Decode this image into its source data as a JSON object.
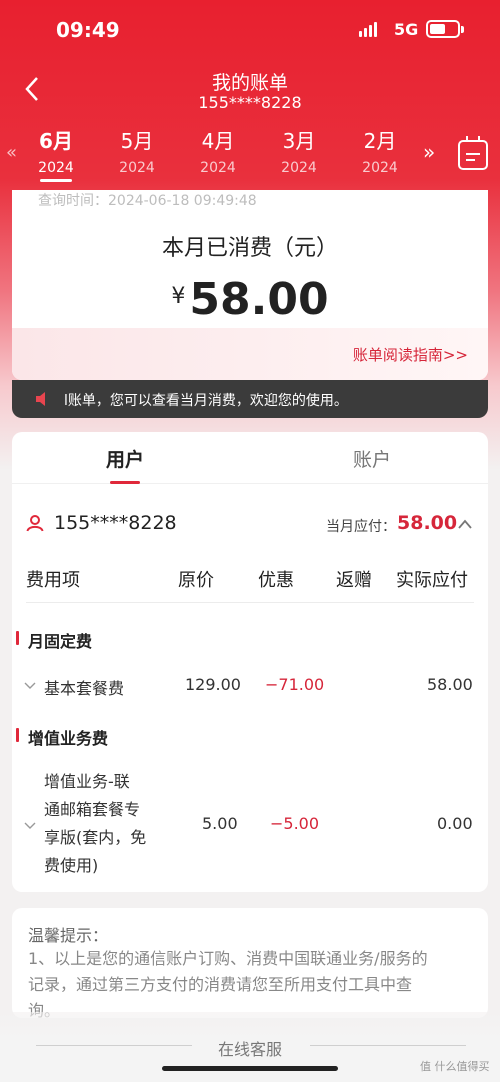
{
  "status_bar": {
    "time": "09:49",
    "network": "5G"
  },
  "nav": {
    "title": "我的账单",
    "subtitle": "155****8228"
  },
  "months": [
    {
      "month": "6月",
      "year": "2024"
    },
    {
      "month": "5月",
      "year": "2024"
    },
    {
      "month": "4月",
      "year": "2024"
    },
    {
      "month": "3月",
      "year": "2024"
    },
    {
      "month": "2月",
      "year": "2024"
    }
  ],
  "summary": {
    "query_time": "查询时间：2024-06-18 09:49:48",
    "label": "本月已消费（元）",
    "currency": "¥",
    "amount": "58.00",
    "guide_link": "账单阅读指南>>"
  },
  "notice": {
    "text": "l账单，您可以查看当月消费，欢迎您的使用。"
  },
  "tabs": {
    "user": "用户",
    "account": "账户"
  },
  "account_row": {
    "number": "155****8228",
    "due_label": "当月应付：",
    "due_value": "58.00"
  },
  "table": {
    "headers": {
      "item": "费用项",
      "original": "原价",
      "discount": "优惠",
      "rebate": "返赠",
      "actual": "实际应付"
    },
    "sections": [
      {
        "title": "月固定费",
        "rows": [
          {
            "name": "基本套餐费",
            "original": "129.00",
            "discount": "−71.00",
            "actual": "58.00"
          }
        ]
      },
      {
        "title": "增值业务费",
        "rows": [
          {
            "name_lines": [
              "增值业务-联",
              "通邮箱套餐专",
              "享版(套内，免",
              "费使用)"
            ],
            "original": "5.00",
            "discount": "−5.00",
            "actual": "0.00"
          }
        ]
      }
    ]
  },
  "tips": {
    "title": "温馨提示：",
    "lines": [
      "1、以上是您的通信账户订购、消费中国联通业务/服务的",
      "记录，通过第三方支付的消费请您至所用支付工具中查",
      "询。"
    ]
  },
  "bottom": {
    "service": "在线客服"
  },
  "watermark": "值 什么值得买",
  "colors": {
    "brand_red": "#e8202f",
    "amount_red": "#d6263a"
  }
}
